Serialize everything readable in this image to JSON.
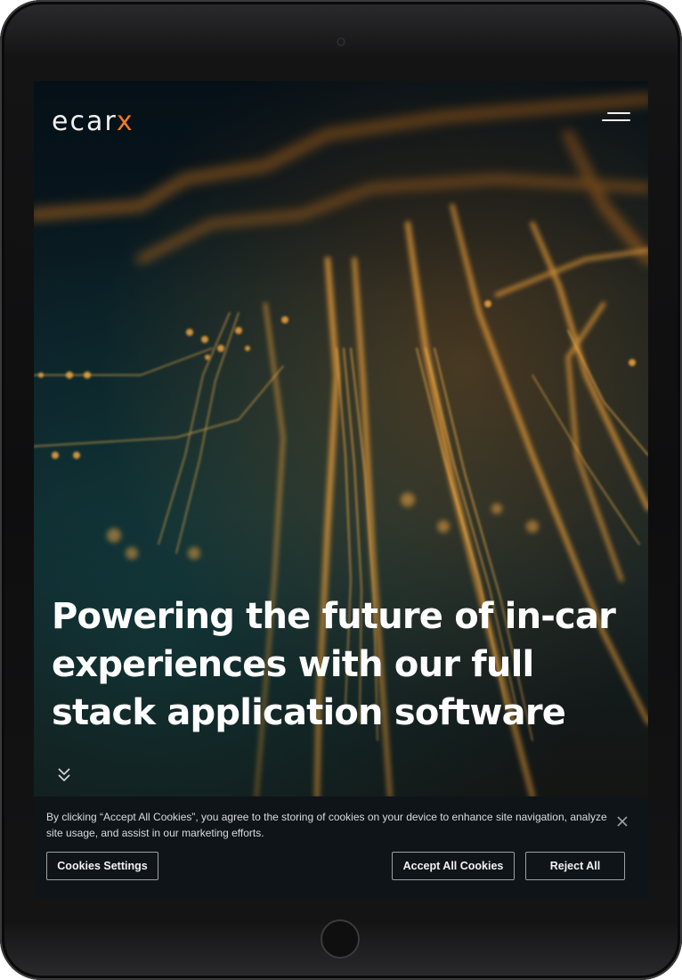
{
  "brand": {
    "logo_main": "ecar",
    "logo_accent": "x",
    "accent_color": "#f07a22"
  },
  "header": {
    "menu_icon": "hamburger-menu-icon"
  },
  "hero": {
    "headline": "Powering the future of in-car experiences with our full stack application software",
    "scroll_icon": "double-chevron-down-icon"
  },
  "cookie_banner": {
    "text": "By clicking “Accept All Cookies”, you agree to the storing of cookies on your device to enhance site navigation, analyze site usage, and assist in our marketing efforts.",
    "close_icon": "close-icon",
    "settings_label": "Cookies Settings",
    "accept_label": "Accept All Cookies",
    "reject_label": "Reject All"
  }
}
